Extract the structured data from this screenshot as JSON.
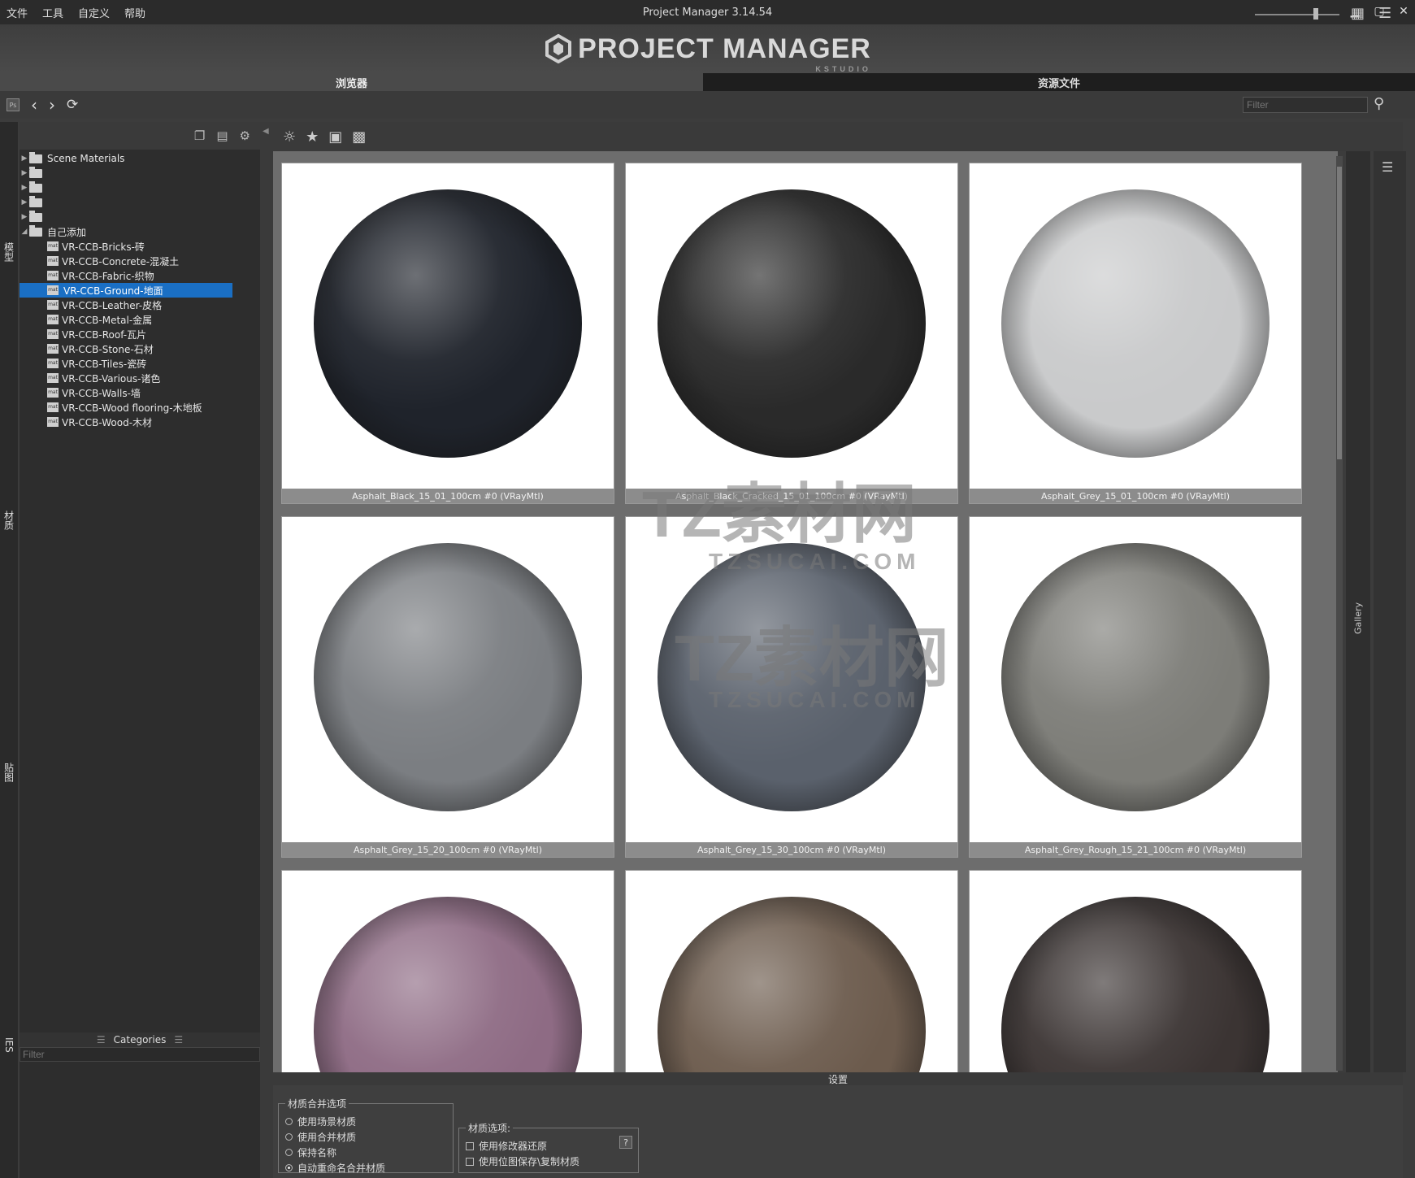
{
  "menu": [
    "文件",
    "工具",
    "自定义",
    "帮助"
  ],
  "window_title": "Project Manager 3.14.54",
  "logo": {
    "text": "PROJECT MANAGER",
    "sub": "KSTUDIO"
  },
  "tabs": {
    "browser": "浏览器",
    "assets": "资源文件"
  },
  "nav": {
    "filter_placeholder": "Filter",
    "ps_label": "Ps"
  },
  "side_tabs": {
    "models": "模型",
    "materials": "材质",
    "maps": "贴图",
    "ies": "IES"
  },
  "tree": {
    "root_label": "Scene Materials",
    "custom_folder": "自己添加",
    "items": [
      "VR-CCB-Bricks-砖",
      "VR-CCB-Concrete-混凝土",
      "VR-CCB-Fabric-织物",
      "VR-CCB-Ground-地面",
      "VR-CCB-Leather-皮格",
      "VR-CCB-Metal-金属",
      "VR-CCB-Roof-瓦片",
      "VR-CCB-Stone-石材",
      "VR-CCB-Tiles-瓷砖",
      "VR-CCB-Various-诸色",
      "VR-CCB-Walls-墙",
      "VR-CCB-Wood flooring-木地板",
      "VR-CCB-Wood-木材"
    ],
    "selected_index": 3
  },
  "categories": {
    "title": "Categories",
    "filter_placeholder": "Filter"
  },
  "gallery": {
    "label": "Gallery",
    "items": [
      {
        "name": "Asphalt_Black_15_01_100cm #0 (VRayMtl)",
        "color": "#1f232b"
      },
      {
        "name": "Asphalt_Black_Cracked_15_01_100cm #0 (VRayMtl)",
        "color": "#2a2a2a"
      },
      {
        "name": "Asphalt_Grey_15_01_100cm #0 (VRayMtl)",
        "color": "#c9cacb"
      },
      {
        "name": "Asphalt_Grey_15_20_100cm #0 (VRayMtl)",
        "color": "#7b7e82"
      },
      {
        "name": "Asphalt_Grey_15_30_100cm #0 (VRayMtl)",
        "color": "#5a616c"
      },
      {
        "name": "Asphalt_Grey_Rough_15_21_100cm #0 (VRayMtl)",
        "color": "#7d7d78"
      },
      {
        "name": "",
        "color": "#8e6b84"
      },
      {
        "name": "",
        "color": "#6c5b4d"
      },
      {
        "name": "",
        "color": "#3b3433"
      }
    ]
  },
  "settings": {
    "title": "设置",
    "merge_group": "材质合并选项",
    "merge_options": [
      "使用场景材质",
      "使用合并材质",
      "保持名称",
      "自动重命名合并材质"
    ],
    "merge_selected": 3,
    "material_group": "材质选项:",
    "material_options": [
      "使用修改器还原",
      "使用位图保存\\复制材质"
    ],
    "help": "?"
  },
  "watermark": {
    "line1": "TZ素材网",
    "line2": "TZSUCAI.COM"
  }
}
